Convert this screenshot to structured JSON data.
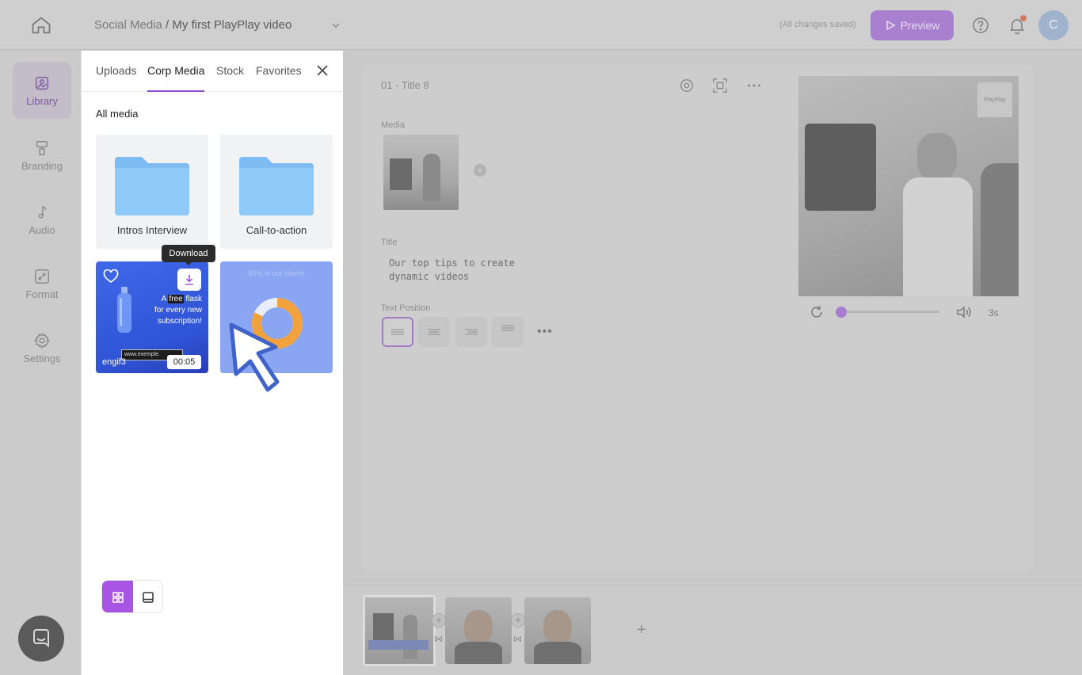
{
  "header": {
    "breadcrumb_folder": "Social Media",
    "breadcrumb_sep": " / ",
    "project_name": "My first PlayPlay video",
    "save_status": "(All changes saved)",
    "preview_label": "Preview",
    "avatar_initial": "C"
  },
  "sidebar": {
    "items": [
      {
        "label": "Library",
        "icon": "image-icon"
      },
      {
        "label": "Branding",
        "icon": "paint-roller-icon"
      },
      {
        "label": "Audio",
        "icon": "music-note-icon"
      },
      {
        "label": "Format",
        "icon": "resize-icon"
      },
      {
        "label": "Settings",
        "icon": "gear-icon"
      }
    ]
  },
  "panel": {
    "tabs": [
      "Uploads",
      "Corp Media",
      "Stock",
      "Favorites"
    ],
    "active_tab": "Corp Media",
    "section_title": "All media",
    "folders": [
      {
        "label": "Intros Interview"
      },
      {
        "label": "Call-to-action"
      }
    ],
    "tooltip": "Download",
    "flask_card": {
      "text_prefix": "A ",
      "text_highlight": "free",
      "text_line1_suffix": " flask",
      "text_line2": "for every new",
      "text_line3": "subscription!",
      "url": "www.exemple.",
      "name": "engif3",
      "duration": "00:05"
    },
    "chart_card": {
      "caption": "82% of our clients",
      "donut_fraction": 0.82
    }
  },
  "editor": {
    "scene_title": "01 - Title 8",
    "media_label": "Media",
    "title_label": "Title",
    "title_line1": "Our top tips to create",
    "title_line2": "dynamic videos",
    "text_position_label": "Text Position",
    "preview_logo": "PlayPlay",
    "duration_label": "3s"
  },
  "colors": {
    "accent": "#8b4fc9",
    "accent_dimmed": "#a97fd0",
    "toggle_active": "#a855e6"
  }
}
